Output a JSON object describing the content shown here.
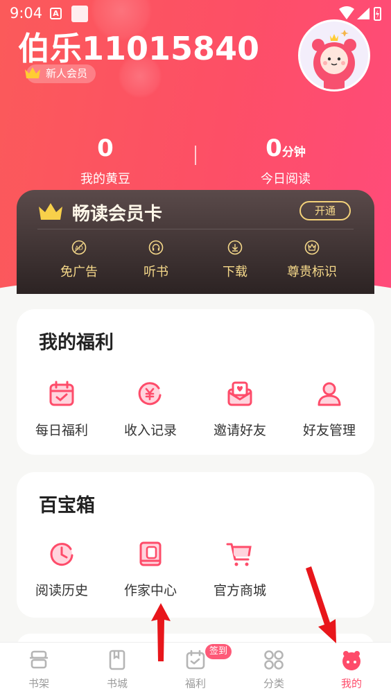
{
  "status_bar": {
    "time": "9:04",
    "a_icon_text": "A"
  },
  "profile": {
    "username": "伯乐11015840",
    "member_badge": "新人会员"
  },
  "stats": [
    {
      "value": "0",
      "unit": "",
      "label": "我的黄豆"
    },
    {
      "value": "0",
      "unit": "分钟",
      "label": "今日阅读"
    }
  ],
  "vip_card": {
    "title": "畅读会员卡",
    "open_button": "开通",
    "features": [
      {
        "label": "免广告",
        "icon": "no-ad-icon"
      },
      {
        "label": "听书",
        "icon": "headphones-icon"
      },
      {
        "label": "下载",
        "icon": "download-icon"
      },
      {
        "label": "尊贵标识",
        "icon": "crown-icon"
      }
    ]
  },
  "welfare": {
    "title": "我的福利",
    "items": [
      {
        "label": "每日福利",
        "icon": "calendar-check-icon"
      },
      {
        "label": "收入记录",
        "icon": "yen-coin-icon"
      },
      {
        "label": "邀请好友",
        "icon": "invite-mail-icon"
      },
      {
        "label": "好友管理",
        "icon": "person-icon"
      }
    ]
  },
  "toolbox": {
    "title": "百宝箱",
    "items": [
      {
        "label": "阅读历史",
        "icon": "clock-icon"
      },
      {
        "label": "作家中心",
        "icon": "book-pen-icon"
      },
      {
        "label": "官方商城",
        "icon": "cart-icon"
      }
    ]
  },
  "tabbar": {
    "sign_badge": "签到",
    "tabs": [
      {
        "label": "书架",
        "icon": "bookshelf-icon",
        "active": false
      },
      {
        "label": "书城",
        "icon": "book-icon",
        "active": false
      },
      {
        "label": "福利",
        "icon": "calendar-icon",
        "active": false
      },
      {
        "label": "分类",
        "icon": "grid-icon",
        "active": false
      },
      {
        "label": "我的",
        "icon": "mine-face-icon",
        "active": true
      }
    ]
  },
  "colors": {
    "brand": "#fe4c6a",
    "gold": "#f6d98a",
    "annotation_arrow": "#e8161b"
  }
}
